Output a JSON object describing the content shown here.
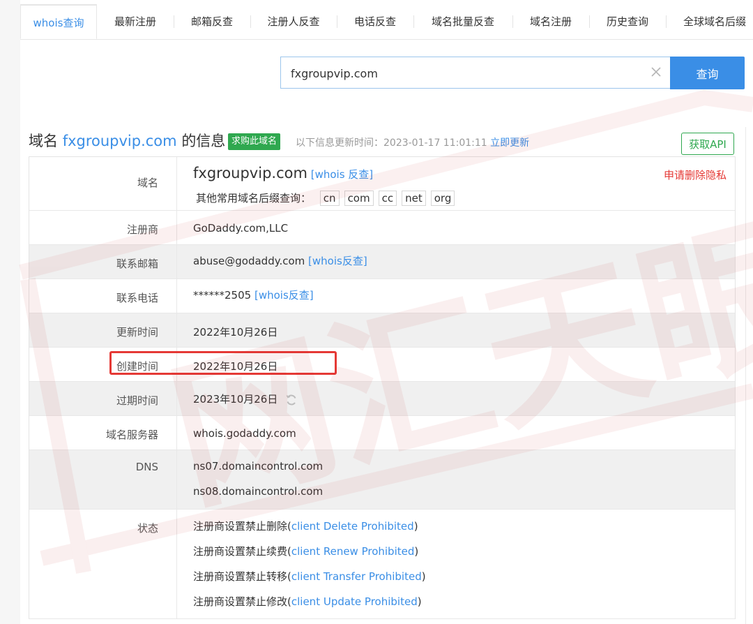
{
  "tabs": [
    {
      "label": "whois查询",
      "active": true
    },
    {
      "label": "最新注册"
    },
    {
      "label": "邮箱反查"
    },
    {
      "label": "注册人反查"
    },
    {
      "label": "电话反查"
    },
    {
      "label": "域名批量反查"
    },
    {
      "label": "域名注册"
    },
    {
      "label": "历史查询"
    },
    {
      "label": "全球域名后缀"
    }
  ],
  "search": {
    "value": "fxgroupvip.com",
    "button": "查询"
  },
  "header": {
    "title_prefix": "域名",
    "domain": "fxgroupvip.com",
    "title_suffix": "的信息",
    "buy_badge": "求购此域名",
    "update_label": "以下信息更新时间：",
    "update_time": "2023-01-17 11:01:11",
    "update_link": "立即更新",
    "api_button": "获取API"
  },
  "record": {
    "domain": {
      "label": "域名",
      "value": "fxgroupvip.com",
      "whois_link": "[whois 反查]",
      "delete_privacy": "申请删除隐私",
      "suffix_label": "其他常用域名后缀查询：",
      "suffixes": [
        "cn",
        "com",
        "cc",
        "net",
        "org"
      ]
    },
    "registrar": {
      "label": "注册商",
      "value": "GoDaddy.com,LLC"
    },
    "email": {
      "label": "联系邮箱",
      "value": "abuse@godaddy.com",
      "link": "[whois反查]"
    },
    "phone": {
      "label": "联系电话",
      "value": "******2505",
      "link": "[whois反查]"
    },
    "updated": {
      "label": "更新时间",
      "value": "2022年10月26日"
    },
    "created": {
      "label": "创建时间",
      "value": "2022年10月26日"
    },
    "expires": {
      "label": "过期时间",
      "value": "2023年10月26日"
    },
    "whois_server": {
      "label": "域名服务器",
      "value": "whois.godaddy.com"
    },
    "dns": {
      "label": "DNS",
      "values": [
        "ns07.domaincontrol.com",
        "ns08.domaincontrol.com"
      ]
    },
    "status": {
      "label": "状态",
      "items": [
        {
          "text": "注册商设置禁止删除",
          "code": "client Delete Prohibited"
        },
        {
          "text": "注册商设置禁止续费",
          "code": "client Renew Prohibited"
        },
        {
          "text": "注册商设置禁止转移",
          "code": "client Transfer Prohibited"
        },
        {
          "text": "注册商设置禁止修改",
          "code": "client Update Prohibited"
        }
      ]
    }
  },
  "colors": {
    "accent": "#3a8ee6",
    "green": "#2fa84f",
    "red": "#e53935"
  },
  "watermark": {
    "text": "网汇天眼"
  }
}
